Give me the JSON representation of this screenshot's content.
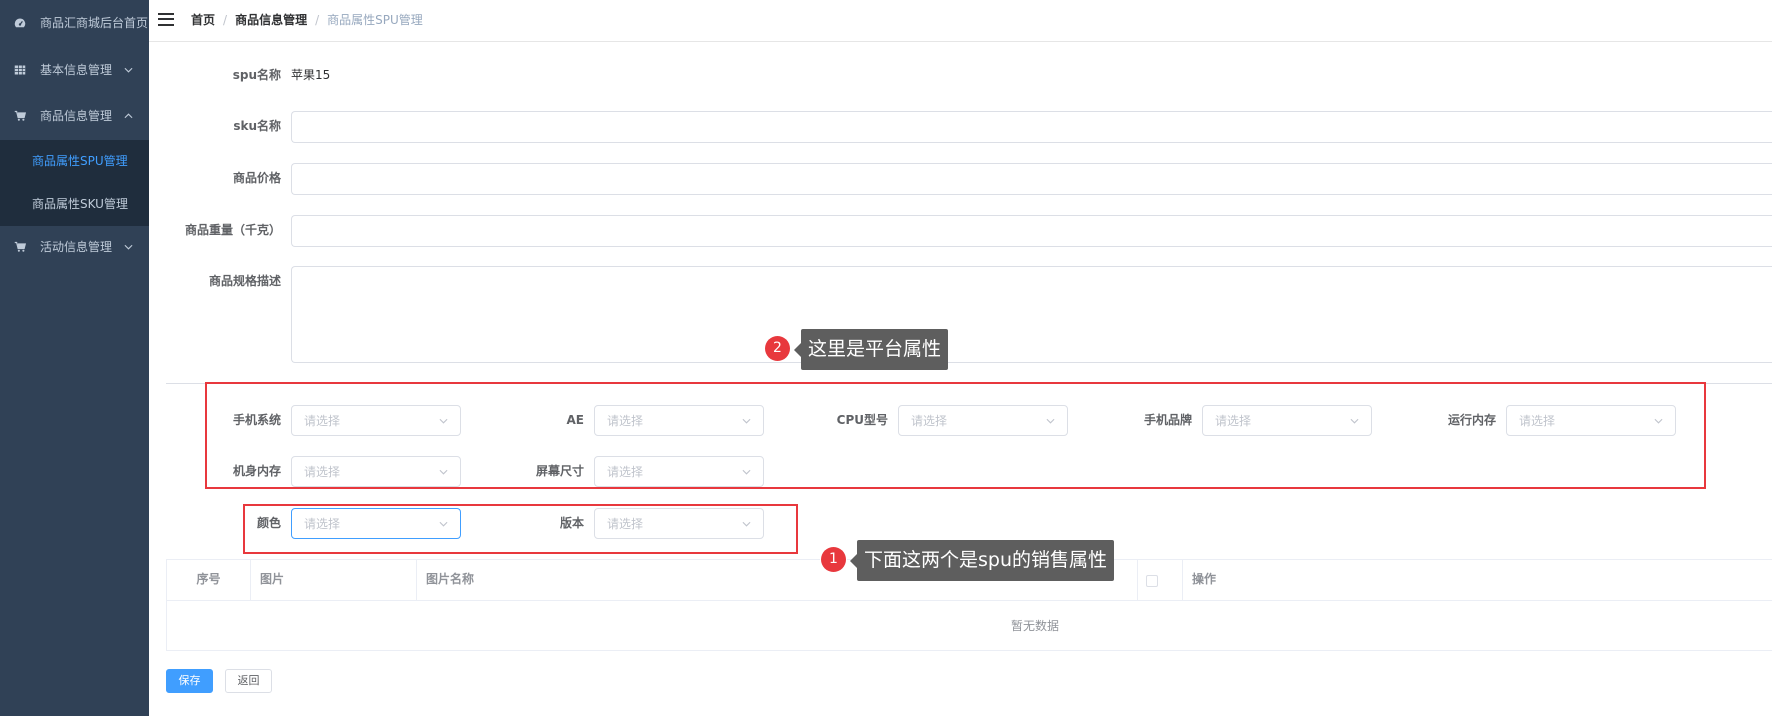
{
  "sidebar": {
    "items": [
      {
        "label": "商品汇商城后台首页",
        "icon": "dashboard-icon"
      },
      {
        "label": "基本信息管理",
        "icon": "grid-icon",
        "chevron": "chevron-down-icon"
      },
      {
        "label": "商品信息管理",
        "icon": "cart-icon",
        "chevron": "chevron-up-icon",
        "expanded": true,
        "children": [
          {
            "label": "商品属性SPU管理",
            "active": true
          },
          {
            "label": "商品属性SKU管理",
            "active": false
          }
        ]
      },
      {
        "label": "活动信息管理",
        "icon": "cart-icon",
        "chevron": "chevron-down-icon"
      }
    ]
  },
  "header": {
    "menu_icon": "hamburger-icon",
    "breadcrumb": [
      "首页",
      "商品信息管理",
      "商品属性SPU管理"
    ],
    "separator": "/"
  },
  "form": {
    "spu_name": {
      "label": "spu名称",
      "value": "苹果15"
    },
    "sku_name": {
      "label": "sku名称"
    },
    "price": {
      "label": "商品价格"
    },
    "weight": {
      "label": "商品重量（千克）"
    },
    "description": {
      "label": "商品规格描述"
    },
    "select_placeholder": "请选择",
    "platform_attrs": [
      {
        "label": "手机系统"
      },
      {
        "label": "AE"
      },
      {
        "label": "CPU型号"
      },
      {
        "label": "手机品牌"
      },
      {
        "label": "运行内存"
      },
      {
        "label": "机身内存"
      },
      {
        "label": "屏幕尺寸"
      }
    ],
    "sale_attrs": [
      {
        "label": "颜色",
        "focused": true
      },
      {
        "label": "版本"
      }
    ]
  },
  "table": {
    "columns": [
      "序号",
      "图片",
      "图片名称",
      "操作"
    ],
    "empty_text": "暂无数据"
  },
  "buttons": {
    "save": "保存",
    "back": "返回"
  },
  "annotations": [
    {
      "number": "1",
      "text": "下面这两个是spu的销售属性"
    },
    {
      "number": "2",
      "text": "这里是平台属性"
    }
  ],
  "colors": {
    "sidebar_bg": "#304156",
    "submenu_bg": "#1f2d3d",
    "accent": "#409EFF",
    "highlight_box": "#e8383d",
    "annotation_badge": "#e8383d",
    "annotation_tooltip": "#5e5e5e"
  }
}
